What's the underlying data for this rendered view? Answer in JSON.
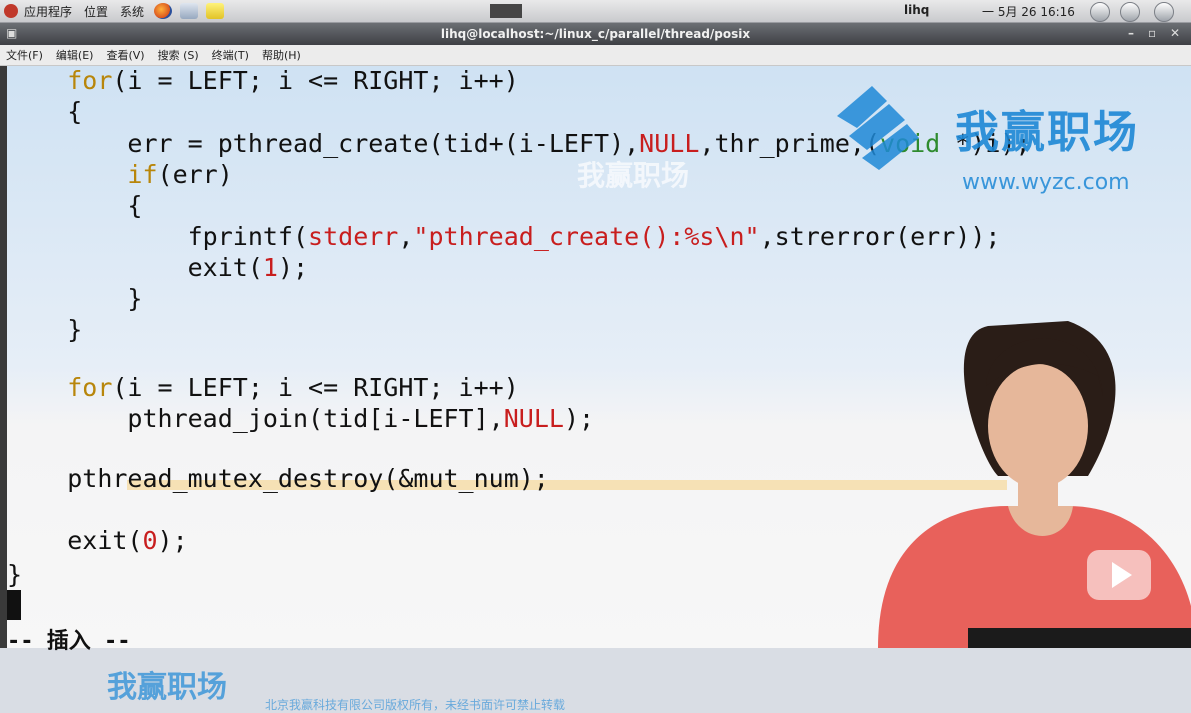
{
  "panel": {
    "menus": [
      "应用程序",
      "位置",
      "系统"
    ],
    "user": "lihq",
    "clock": "一 5月 26 16:16"
  },
  "window": {
    "title": "lihq@localhost:~/linux_c/parallel/thread/posix",
    "buttons": [
      "–",
      "▫",
      "✕"
    ],
    "menus": [
      "文件(F)",
      "编辑(E)",
      "查看(V)",
      "搜索 (S)",
      "终端(T)",
      "帮助(H)"
    ]
  },
  "code": {
    "lines": [
      {
        "indent": "    ",
        "parts": [
          [
            "kw",
            "for"
          ],
          [
            "n",
            "(i = LEFT; i <= RIGHT; i++)"
          ]
        ]
      },
      {
        "indent": "    ",
        "parts": [
          [
            "n",
            "{"
          ]
        ]
      },
      {
        "indent": "        ",
        "parts": [
          [
            "n",
            "err = pthread_create(tid+(i-LEFT),"
          ],
          [
            "nul",
            "NULL"
          ],
          [
            "n",
            ",thr_prime,("
          ],
          [
            "ty",
            "void"
          ],
          [
            "n",
            " *)i);"
          ]
        ]
      },
      {
        "indent": "        ",
        "parts": [
          [
            "kw",
            "if"
          ],
          [
            "n",
            "(err)"
          ]
        ]
      },
      {
        "indent": "        ",
        "parts": [
          [
            "n",
            "{"
          ]
        ]
      },
      {
        "indent": "            ",
        "parts": [
          [
            "n",
            "fprintf("
          ],
          [
            "nul",
            "stderr"
          ],
          [
            "n",
            ","
          ],
          [
            "str",
            "\"pthread_create():%s\\n\""
          ],
          [
            "n",
            ",strerror(err));"
          ]
        ]
      },
      {
        "indent": "            ",
        "parts": [
          [
            "n",
            "exit("
          ],
          [
            "num",
            "1"
          ],
          [
            "n",
            ");"
          ]
        ]
      },
      {
        "indent": "        ",
        "parts": [
          [
            "n",
            "}"
          ]
        ]
      },
      {
        "indent": "    ",
        "parts": [
          [
            "n",
            "}"
          ]
        ]
      },
      {
        "indent": "",
        "parts": [
          [
            "n",
            ""
          ]
        ]
      },
      {
        "indent": "    ",
        "parts": [
          [
            "kw",
            "for"
          ],
          [
            "n",
            "(i = LEFT; i <= RIGHT; i++)"
          ]
        ]
      },
      {
        "indent": "        ",
        "parts": [
          [
            "n",
            "pthread_join(tid[i-LEFT],"
          ],
          [
            "nul",
            "NULL"
          ],
          [
            "n",
            ");"
          ]
        ]
      },
      {
        "indent": "",
        "parts": [
          [
            "n",
            ""
          ]
        ]
      },
      {
        "indent": "    ",
        "parts": [
          [
            "n",
            "pthread_mutex_destroy(&mut_num);"
          ]
        ]
      },
      {
        "indent": "",
        "parts": [
          [
            "n",
            ""
          ]
        ]
      },
      {
        "indent": "    ",
        "parts": [
          [
            "n",
            "exit("
          ],
          [
            "num",
            "0"
          ],
          [
            "n",
            ");"
          ]
        ]
      },
      {
        "indent": "",
        "parts": [
          [
            "n",
            ""
          ]
        ]
      },
      {
        "indent": "",
        "parts": [
          [
            "n",
            "}"
          ]
        ]
      }
    ],
    "status": "-- 插入 --"
  },
  "watermark": {
    "brand": "我赢职场",
    "url": "www.wyzc.com",
    "copyright": "北京我赢科技有限公司版权所有，未经书面许可禁止转载"
  },
  "colors": {
    "keyword": "#b8860b",
    "constant": "#c81e1e",
    "type": "#2e8b2e",
    "watermark": "#1e88d6"
  }
}
